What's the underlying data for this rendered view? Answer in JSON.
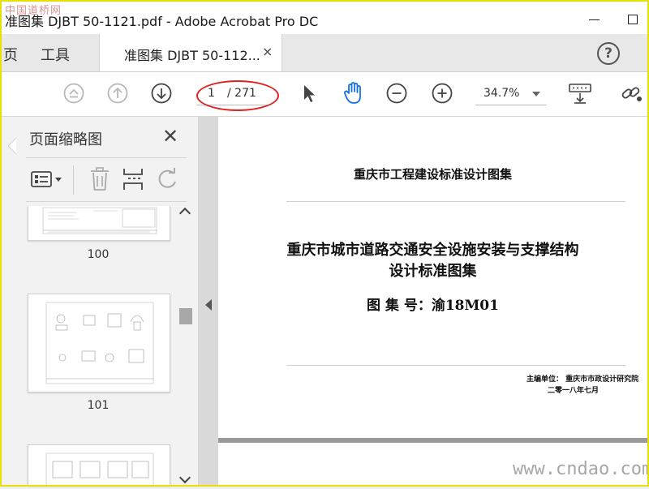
{
  "window": {
    "title": "准图集 DJBT 50-1121.pdf - Adobe Acrobat Pro DC",
    "watermark_top": "中国道桥网"
  },
  "tabs": {
    "home": "页",
    "tools": "工具",
    "document": "准图集 DJBT 50-112...",
    "close": "×",
    "help": "?"
  },
  "toolbar": {
    "current_page": "1",
    "total_pages": "/ 271",
    "zoom": "34.7%",
    "icons": [
      "first-page-icon",
      "prev-page-icon",
      "next-page-icon",
      "select-arrow-icon",
      "hand-tool-icon",
      "zoom-out-icon",
      "zoom-in-icon",
      "page-display-icon",
      "share-link-icon"
    ],
    "accent_color": "#1473e6",
    "highlight_color": "#e02020"
  },
  "sidebar": {
    "title": "页面缩略图",
    "close": "✕",
    "tools": [
      "thumbnail-options-icon",
      "delete-page-icon",
      "insert-page-icon",
      "rotate-page-icon"
    ],
    "thumbnails": [
      {
        "label": "100"
      },
      {
        "label": "101"
      },
      {
        "label": ""
      }
    ]
  },
  "document": {
    "header": "重庆市工程建设标准设计图集",
    "title_line1": "重庆市城市道路交通安全设施安装与支撑结构",
    "title_line2": "设计标准图集",
    "atlas_number": "图 集 号：渝18M01",
    "editor": "主编单位：  重庆市市政设计研究院",
    "date": "二零一八年七月"
  },
  "watermark_bottom": "www.cndao.com"
}
